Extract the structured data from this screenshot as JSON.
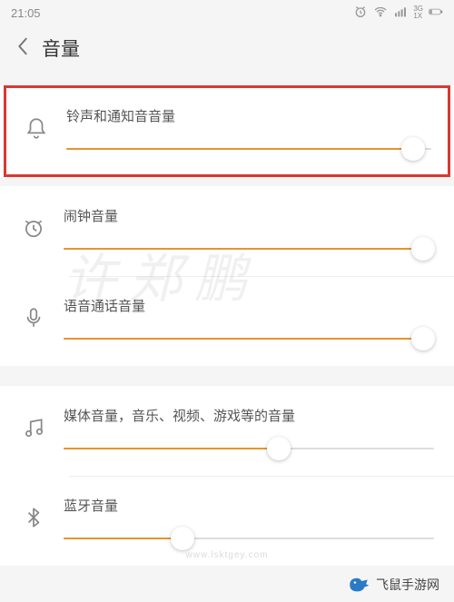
{
  "status": {
    "time": "21:05",
    "net_top": "3G",
    "net_bot": "1X"
  },
  "header": {
    "title": "音量"
  },
  "sliders": {
    "ringtone": {
      "label": "铃声和通知音音量",
      "value": 95
    },
    "alarm": {
      "label": "闹钟音量",
      "value": 97
    },
    "voice": {
      "label": "语音通话音量",
      "value": 97
    },
    "media": {
      "label": "媒体音量，音乐、视频、游戏等的音量",
      "value": 58
    },
    "bluetooth": {
      "label": "蓝牙音量",
      "value": 32
    }
  },
  "colors": {
    "slider_fill": "#e8932e",
    "highlight_border": "#d93833"
  },
  "watermark": "许郑鹏",
  "domain_strip": "www.lsktgey.com",
  "brand": "飞鼠手游网"
}
